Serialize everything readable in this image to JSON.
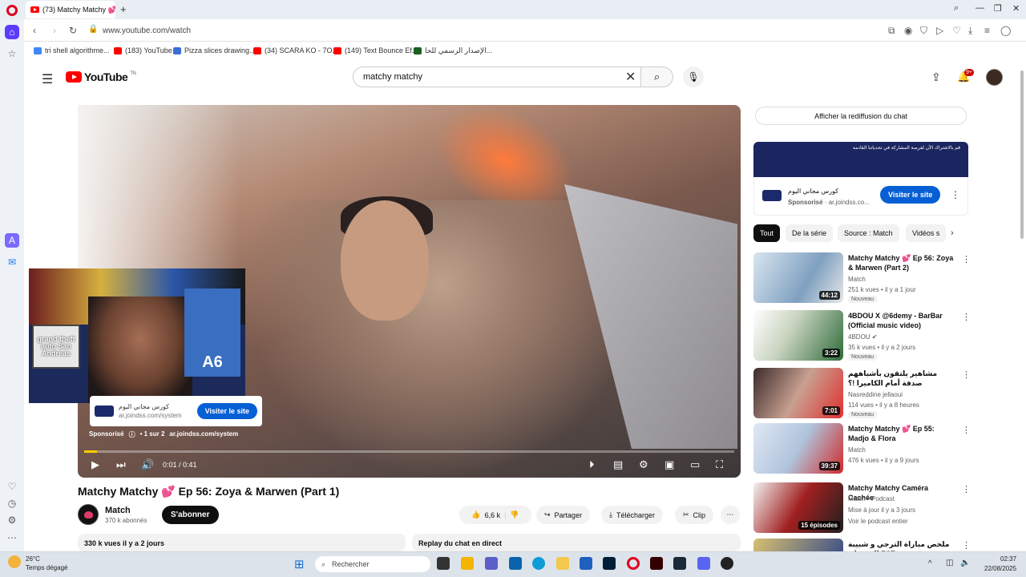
{
  "browser": {
    "tab_title": "(73) Matchy Matchy 💕 E",
    "url": "www.youtube.com/watch",
    "bookmarks": [
      {
        "label": "tri shell algorithme..."
      },
      {
        "label": "(183) YouTube"
      },
      {
        "label": "Pizza slices drawing..."
      },
      {
        "label": "(34) SCARA KO - 7O..."
      },
      {
        "label": "(149) Text Bounce Ef..."
      },
      {
        "label": "الإصدار الرسمي للحا..."
      }
    ]
  },
  "youtube": {
    "logo_text": "YouTube",
    "logo_region": "TN",
    "search_value": "matchy matchy",
    "notification_count": "9+"
  },
  "player": {
    "ad_title": "كورس مجاني اليوم",
    "ad_domain": "ar.joindss.com/system",
    "ad_button": "Visiter le site",
    "sponsored": "Sponsorisé",
    "ad_counter": "• 1 sur 2",
    "ad_url": "ar.joindss.com/system",
    "time": "0:01 / 0:41",
    "progress_fraction": 0.02,
    "overlay_sign": "A6",
    "overlay_game": "grand theft auto San Andreas"
  },
  "video": {
    "title": "Matchy Matchy 💕 Ep 56: Zoya & Marwen (Part 1)",
    "channel": "Match",
    "subscribers": "370 k abonnés",
    "subscribe_label": "S'abonner",
    "likes": "6,6 k",
    "share_label": "Partager",
    "download_label": "Télécharger",
    "clip_label": "Clip",
    "views_date": "330 k vues  il y a 2 jours",
    "chat_replay": "Replay du chat en direct"
  },
  "sidebar": {
    "chat_button": "Afficher la rediffusion du chat",
    "promo": {
      "banner_text": "قم بالاشتراك الآن لفرصة المشاركة في تحدياتنا القادمة",
      "title": "كورس مجاني اليوم",
      "sponsored": "Sponsorisé",
      "domain": "ar.joindss.co...",
      "button": "Visiter le site"
    },
    "chips": [
      "Tout",
      "De la série",
      "Source : Match",
      "Vidéos s"
    ],
    "recommendations": [
      {
        "title": "Matchy Matchy 💕 Ep 56: Zoya & Marwen (Part 2)",
        "channel": "Match",
        "meta": "251 k vues • il y a 1 jour",
        "badge": "Nouveau",
        "duration": "44:12"
      },
      {
        "title": "4BDOU X @6demy - BarBar (Official music video)",
        "channel": "4BDOU ✔",
        "meta": "35 k vues • il y a 2 jours",
        "badge": "Nouveau",
        "duration": "3:22"
      },
      {
        "title": "مشاهير يلتقون بأشباههم صدفة أمام الكاميرا !؟",
        "channel": "Nasreddine jellaoui",
        "meta": "114 vues • il y a 8 heures",
        "badge": "Nouveau",
        "duration": "7:01"
      },
      {
        "title": "Matchy Matchy 💕 Ep 55: Madjo & Flora",
        "channel": "Match",
        "meta": "476 k vues • il y a 9 jours",
        "badge": "",
        "duration": "39:37"
      },
      {
        "title": "Matchy Matchy Caméra Cachée",
        "channel": "Match • Podcast",
        "meta": "Mise à jour il y a 3 jours",
        "badge": "Voir le podcast entier",
        "duration": "15 épisodes"
      },
      {
        "title": "ملخص مباراة الترجي و شبيبة القيروان EST",
        "channel": "",
        "meta": "",
        "badge": "",
        "duration": ""
      }
    ]
  },
  "taskbar": {
    "temperature": "26°C",
    "condition": "Temps dégagé",
    "search_placeholder": "Rechercher",
    "time": "02:37",
    "date": "22/08/2025"
  },
  "colors": {
    "accent": "#065fd4",
    "youtube_red": "#ff0000",
    "opera_red": "#e0001a"
  }
}
